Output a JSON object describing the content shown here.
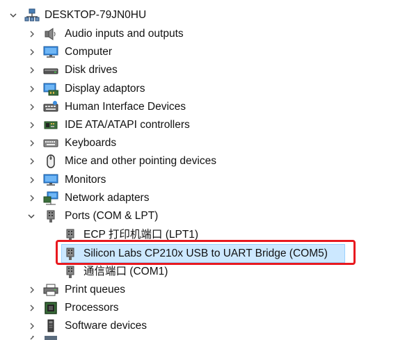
{
  "root": {
    "label": "DESKTOP-79JN0HU",
    "icon": "computer-tree-icon",
    "expanded": true
  },
  "categories": [
    {
      "label": "Audio inputs and outputs",
      "icon": "speaker-icon"
    },
    {
      "label": "Computer",
      "icon": "monitor-icon"
    },
    {
      "label": "Disk drives",
      "icon": "disk-drive-icon"
    },
    {
      "label": "Display adaptors",
      "icon": "display-adapter-icon"
    },
    {
      "label": "Human Interface Devices",
      "icon": "hid-icon"
    },
    {
      "label": "IDE ATA/ATAPI controllers",
      "icon": "ide-controller-icon"
    },
    {
      "label": "Keyboards",
      "icon": "keyboard-icon"
    },
    {
      "label": "Mice and other pointing devices",
      "icon": "mouse-icon"
    },
    {
      "label": "Monitors",
      "icon": "monitor-icon"
    },
    {
      "label": "Network adapters",
      "icon": "network-icon"
    },
    {
      "label": "Ports (COM & LPT)",
      "icon": "port-icon",
      "expanded": true
    }
  ],
  "ports_children": [
    {
      "label": "ECP 打印机端口 (LPT1)",
      "icon": "port-icon"
    },
    {
      "label": "Silicon Labs CP210x USB to UART Bridge (COM5)",
      "icon": "port-icon",
      "selected": true
    },
    {
      "label": "通信端口 (COM1)",
      "icon": "port-icon"
    }
  ],
  "after_categories": [
    {
      "label": "Print queues",
      "icon": "printer-icon"
    },
    {
      "label": "Processors",
      "icon": "processor-icon"
    },
    {
      "label": "Software devices",
      "icon": "software-device-icon"
    }
  ],
  "colors": {
    "selection_bg": "#cce8ff",
    "selection_border": "#99d1ff",
    "annotation_red": "#e8191f",
    "chevron": "#555555"
  }
}
